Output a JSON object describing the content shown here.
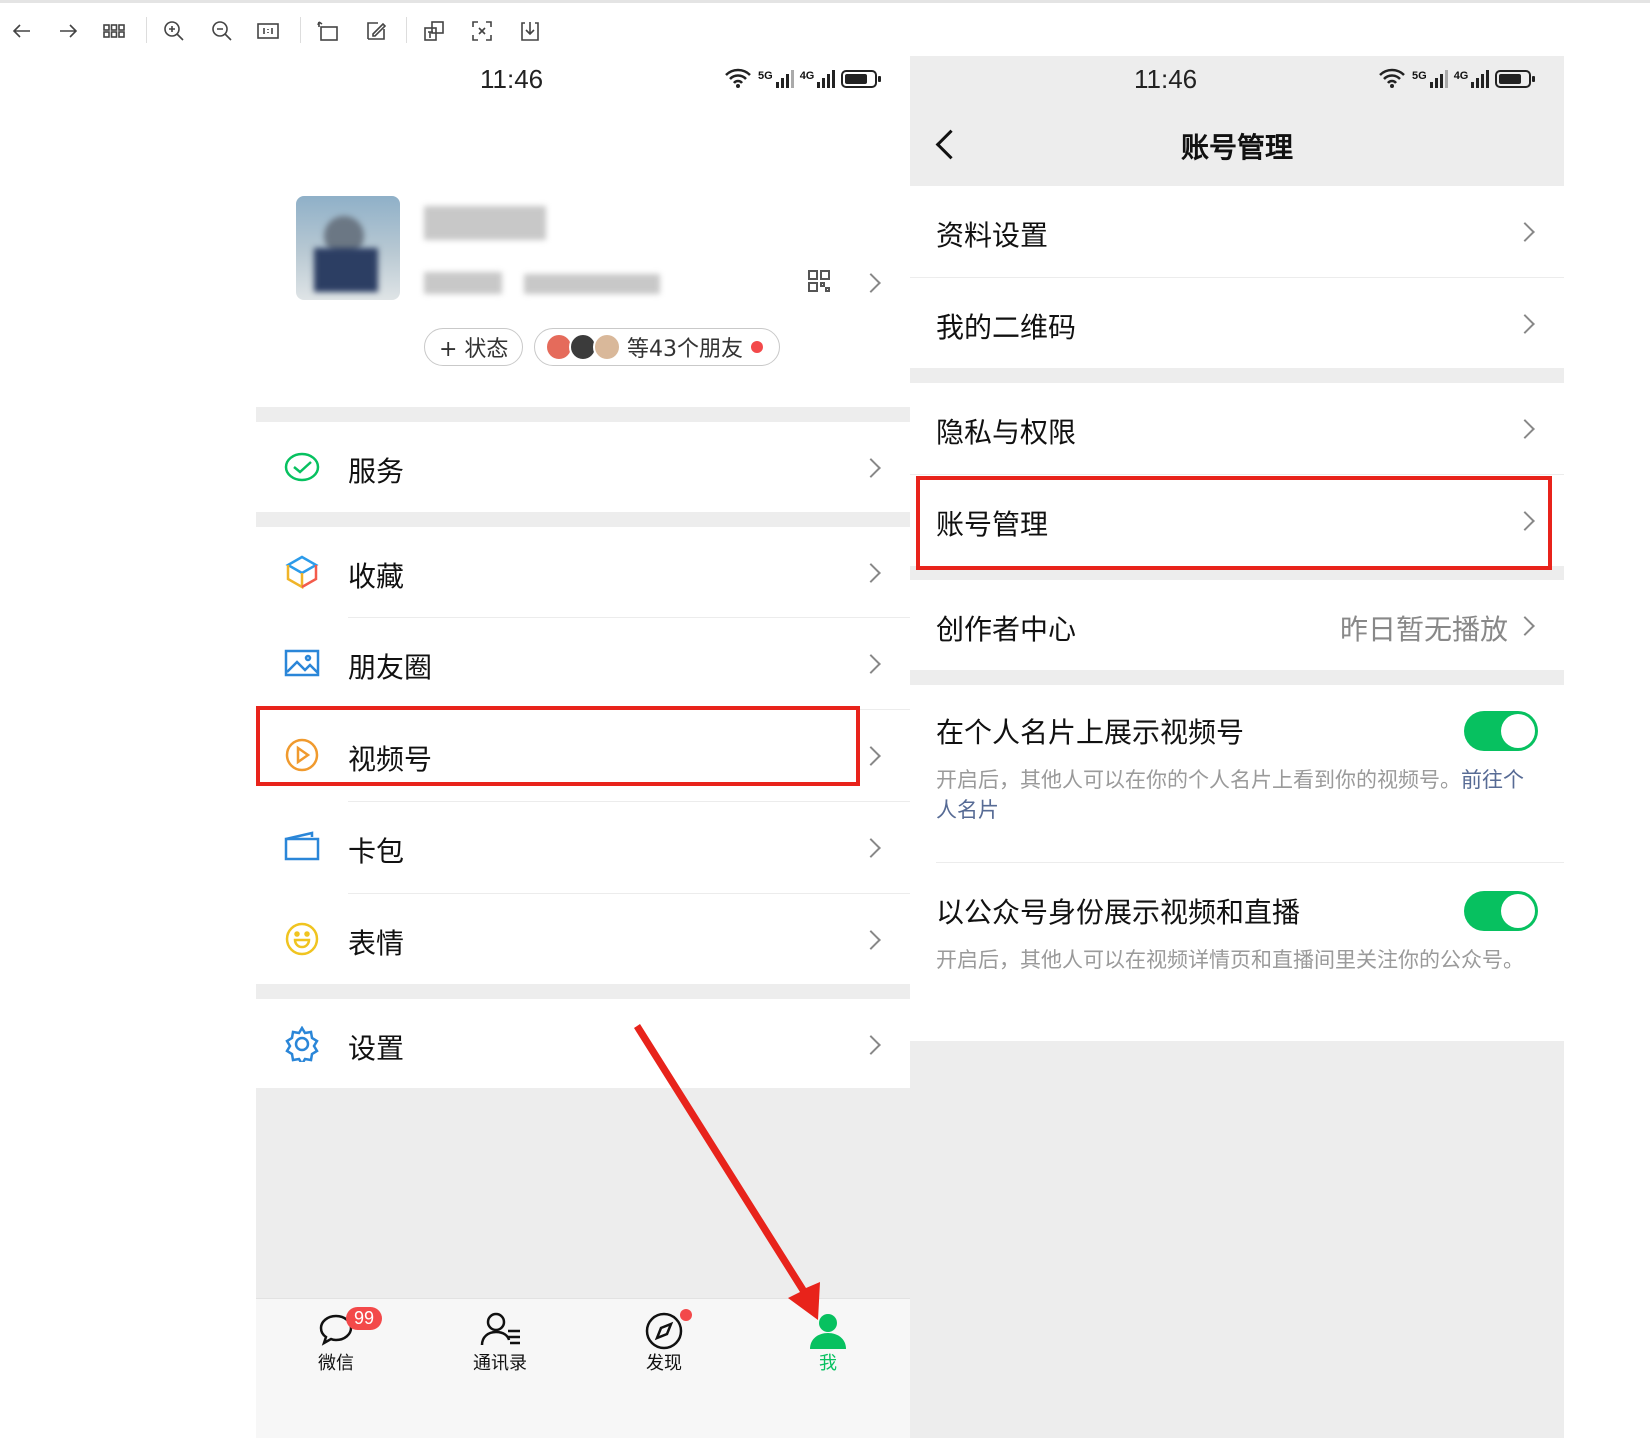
{
  "toolbar": {
    "buttons": [
      "back-arrow-icon",
      "forward-arrow-icon",
      "grid-icon",
      "zoom-in-icon",
      "zoom-out-icon",
      "actual-size-icon",
      "rotate-icon",
      "edit-icon",
      "translate-icon",
      "scan-icon",
      "download-icon"
    ]
  },
  "left_phone": {
    "status": {
      "time": "11:46",
      "net1": "5G",
      "net2": "4G"
    },
    "profile": {
      "status_label": "+ 状态",
      "friends_label": "等43个朋友"
    },
    "menu": [
      {
        "label": "服务",
        "icon": "service-icon"
      },
      {
        "label": "收藏",
        "icon": "favorites-cube-icon"
      },
      {
        "label": "朋友圈",
        "icon": "moments-picture-icon"
      },
      {
        "label": "视频号",
        "icon": "channels-play-icon"
      },
      {
        "label": "卡包",
        "icon": "card-wallet-icon"
      },
      {
        "label": "表情",
        "icon": "sticker-smile-icon"
      },
      {
        "label": "设置",
        "icon": "settings-gear-icon"
      }
    ],
    "tabs": [
      {
        "label": "微信",
        "icon": "chat-bubble-icon",
        "badge": "99"
      },
      {
        "label": "通讯录",
        "icon": "contacts-icon"
      },
      {
        "label": "发现",
        "icon": "discover-compass-icon"
      },
      {
        "label": "我",
        "icon": "me-person-icon"
      }
    ],
    "colors": {
      "accent": "#07c160",
      "highlight": "#e8231b"
    }
  },
  "right_phone": {
    "status": {
      "time": "11:46",
      "net1": "5G",
      "net2": "4G"
    },
    "header": {
      "title": "账号管理"
    },
    "items": [
      {
        "label": "资料设置"
      },
      {
        "label": "我的二维码"
      },
      {
        "label": "隐私与权限"
      },
      {
        "label": "账号管理"
      },
      {
        "label": "创作者中心",
        "value": "昨日暂无播放"
      }
    ],
    "toggles": [
      {
        "label": "在个人名片上展示视频号",
        "desc": "开启后，其他人可以在你的个人名片上看到你的视频号。",
        "link": "前往个人名片",
        "on": true
      },
      {
        "label": "以公众号身份展示视频和直播",
        "desc": "开启后，其他人可以在视频详情页和直播间里关注你的公众号。",
        "on": true
      }
    ]
  }
}
